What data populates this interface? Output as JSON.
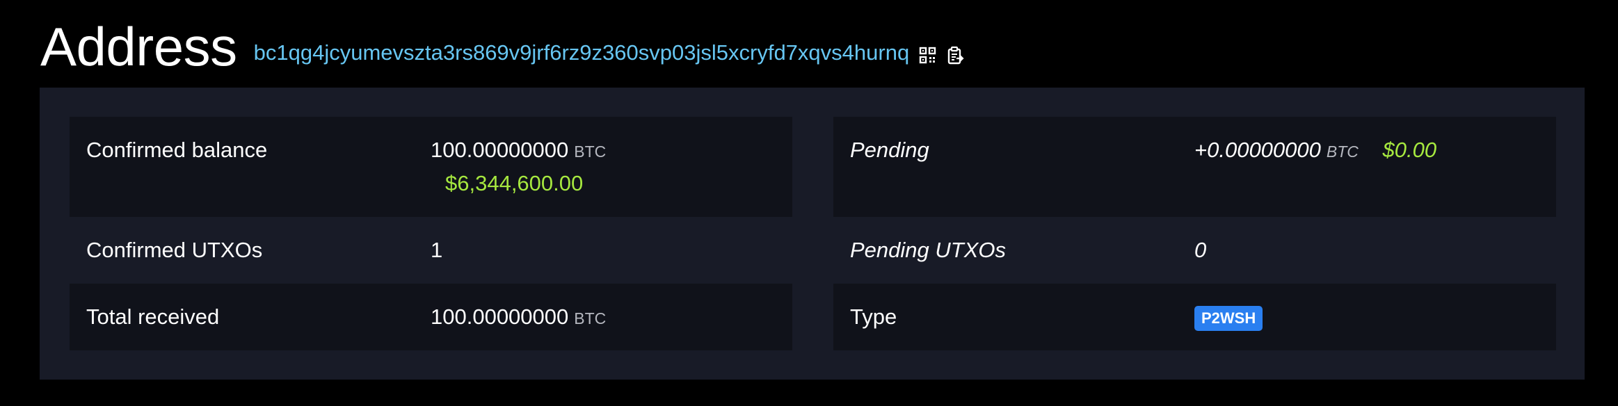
{
  "header": {
    "title": "Address",
    "address": "bc1qg4jcyumevszta3rs869v9jrf6rz9z360svp03jsl5xcryfd7xqvs4hurnq",
    "qr_icon": "qr-code-icon",
    "copy_icon": "clipboard-copy-icon"
  },
  "left": {
    "confirmed_balance": {
      "label": "Confirmed balance",
      "value": "100.00000000",
      "unit": "BTC",
      "fiat": "$6,344,600.00"
    },
    "confirmed_utxos": {
      "label": "Confirmed UTXOs",
      "value": "1"
    },
    "total_received": {
      "label": "Total received",
      "value": "100.00000000",
      "unit": "BTC"
    }
  },
  "right": {
    "pending": {
      "label": "Pending",
      "value": "+0.00000000",
      "unit": "BTC",
      "fiat": "$0.00"
    },
    "pending_utxos": {
      "label": "Pending UTXOs",
      "value": "0"
    },
    "type": {
      "label": "Type",
      "badge": "P2WSH"
    }
  },
  "colors": {
    "background": "#000000",
    "panel": "#181b27",
    "row_shaded": "#10121a",
    "address_link": "#67c6f2",
    "fiat_green": "#a6e83f",
    "badge_blue": "#2a7ff0"
  }
}
